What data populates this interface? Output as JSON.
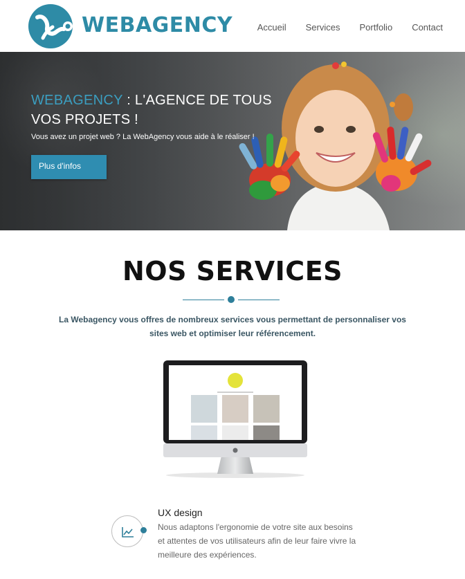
{
  "header": {
    "logo_text": "WEBAGENCY",
    "nav": [
      "Accueil",
      "Services",
      "Portfolio",
      "Contact"
    ]
  },
  "hero": {
    "title_accent": "WEBAGENCY",
    "title_rest": " : L'AGENCE DE TOUS VOS PROJETS !",
    "subtitle": "Vous avez un projet web ? La WebAgency vous aide à le réaliser !",
    "button_label": "Plus d'infos"
  },
  "services": {
    "title": "NOS SERVICES",
    "description": "La Webagency vous offres de nombreux services vous permettant de personnaliser vos sites web et optimiser leur référencement."
  },
  "feature": {
    "icon": "line-chart-icon",
    "title": "UX design",
    "text": "Nous adaptons l'ergonomie de votre site aux besoins et attentes de vos utilisateurs afin de leur faire vivre la meilleure des expériences."
  },
  "colors": {
    "accent": "#2e8ba6",
    "button": "#2f8db1"
  }
}
